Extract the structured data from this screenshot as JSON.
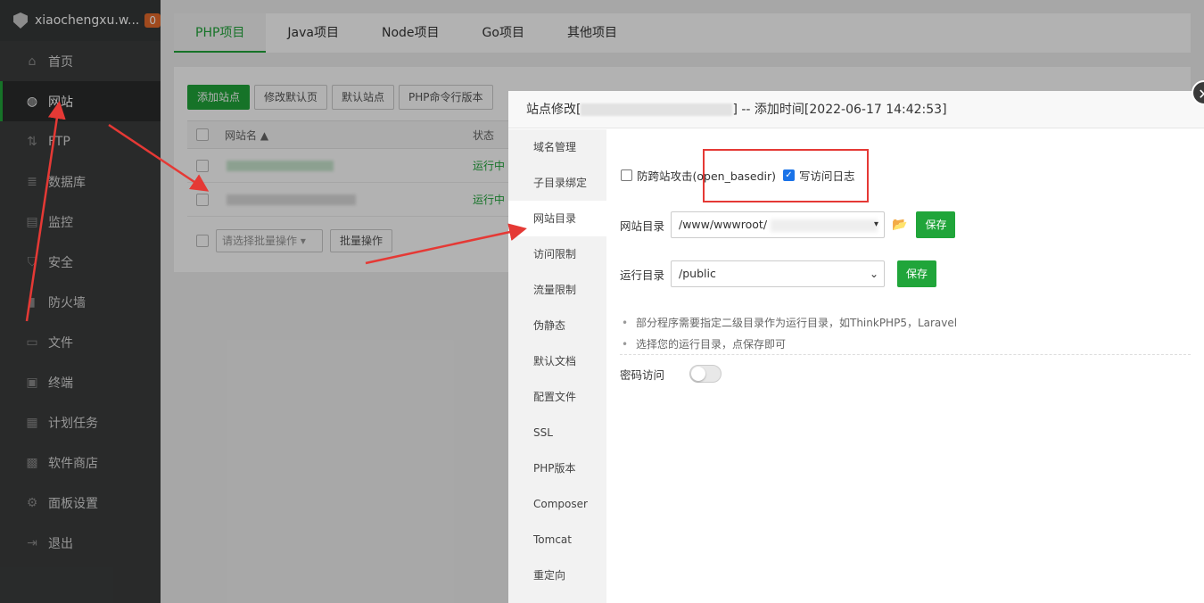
{
  "sidebar": {
    "brand": "xiaochengxu.w...",
    "badge": "0",
    "items": [
      {
        "label": "首页",
        "icon": "home-icon"
      },
      {
        "label": "网站",
        "icon": "globe-icon"
      },
      {
        "label": "FTP",
        "icon": "ftp-icon"
      },
      {
        "label": "数据库",
        "icon": "database-icon"
      },
      {
        "label": "监控",
        "icon": "monitor-icon"
      },
      {
        "label": "安全",
        "icon": "shield-icon"
      },
      {
        "label": "防火墙",
        "icon": "firewall-icon"
      },
      {
        "label": "文件",
        "icon": "folder-icon"
      },
      {
        "label": "终端",
        "icon": "terminal-icon"
      },
      {
        "label": "计划任务",
        "icon": "calendar-icon"
      },
      {
        "label": "软件商店",
        "icon": "apps-icon"
      },
      {
        "label": "面板设置",
        "icon": "gear-icon"
      },
      {
        "label": "退出",
        "icon": "logout-icon"
      }
    ]
  },
  "tabs": [
    "PHP项目",
    "Java项目",
    "Node项目",
    "Go项目",
    "其他项目"
  ],
  "toolbar": {
    "add_site": "添加站点",
    "edit_default_page": "修改默认页",
    "default_site": "默认站点",
    "php_cli_version": "PHP命令行版本"
  },
  "table": {
    "col_name": "网站名 ▲",
    "col_status": "状态",
    "rows": [
      {
        "status": "运行中"
      },
      {
        "status": "运行中"
      }
    ],
    "batch_placeholder": "请选择批量操作",
    "batch_button": "批量操作"
  },
  "modal": {
    "title_prefix": "站点修改[",
    "title_suffix": "] -- 添加时间[2022-06-17 14:42:53]",
    "close": "✕",
    "menu": [
      "域名管理",
      "子目录绑定",
      "网站目录",
      "访问限制",
      "流量限制",
      "伪静态",
      "默认文档",
      "配置文件",
      "SSL",
      "PHP版本",
      "Composer",
      "Tomcat",
      "重定向"
    ],
    "active_menu_index": 2,
    "open_basedir_label": "防跨站攻击(open_basedir)",
    "open_basedir_checked": false,
    "access_log_label": "写访问日志",
    "access_log_checked": true,
    "site_dir_label": "网站目录",
    "site_dir_value": "/www/wwwroot/",
    "save_label": "保存",
    "run_dir_label": "运行目录",
    "run_dir_value": "/public",
    "tips": [
      "部分程序需要指定二级目录作为运行目录，如ThinkPHP5，Laravel",
      "选择您的运行目录，点保存即可"
    ],
    "password_access_label": "密码访问",
    "password_access_on": false
  },
  "colors": {
    "accent": "#20a53a",
    "annotation": "#e53935"
  }
}
